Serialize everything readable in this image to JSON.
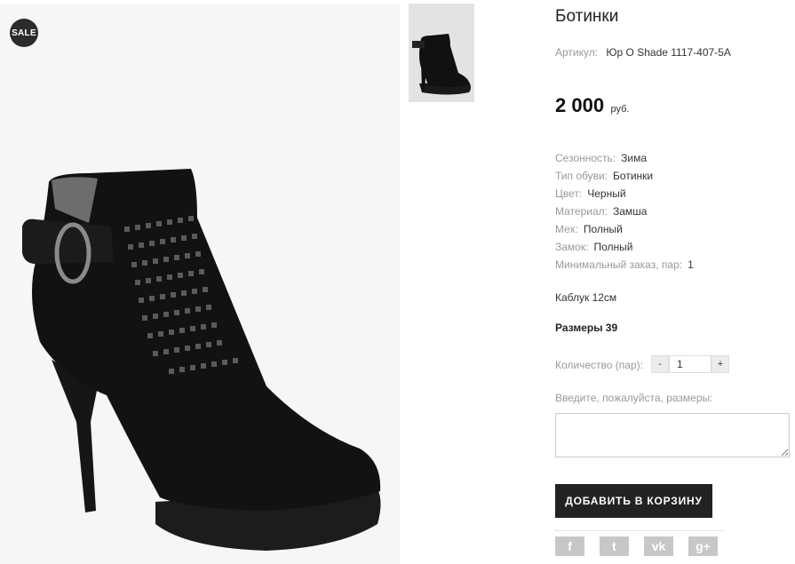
{
  "product": {
    "badge": "SALE",
    "title": "Ботинки",
    "article_label": "Артикул:",
    "article_value": "Юр О Shade 1117-407-5А",
    "price_value": "2 000",
    "price_currency": "руб."
  },
  "properties": [
    {
      "label": "Сезонность:",
      "value": "Зима"
    },
    {
      "label": "Тип обуви:",
      "value": "Ботинки"
    },
    {
      "label": "Цвет:",
      "value": "Черный"
    },
    {
      "label": "Материал:",
      "value": "Замша"
    },
    {
      "label": "Мех:",
      "value": "Полный"
    },
    {
      "label": "Замок:",
      "value": "Полный"
    },
    {
      "label": "Минимальный заказ, пар:",
      "value": "1"
    }
  ],
  "heel_text": "Каблук 12см",
  "sizes_text": "Размеры 39",
  "quantity": {
    "label": "Количество (пар):",
    "minus": "-",
    "value": "1",
    "plus": "+"
  },
  "sizes_prompt": "Введите, пожалуйста, размеры:",
  "add_to_cart_label": "ДОБАВИТЬ В КОРЗИНУ",
  "social": [
    {
      "name": "facebook-icon",
      "glyph": "f"
    },
    {
      "name": "twitter-icon",
      "glyph": "t"
    },
    {
      "name": "vk-icon",
      "glyph": "vk"
    },
    {
      "name": "google-plus-icon",
      "glyph": "g+"
    }
  ],
  "colors": {
    "button_bg": "#222222",
    "badge_bg": "#2b2b2b",
    "social_bg": "#c7c7c7"
  }
}
